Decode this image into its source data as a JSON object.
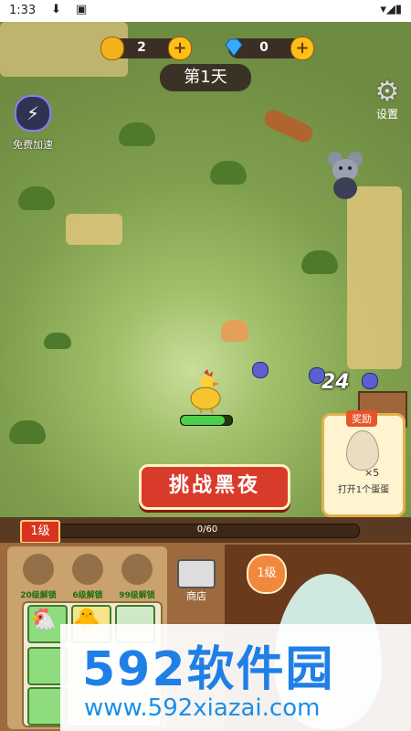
{
  "status_bar": {
    "time": "1:33",
    "left_icons": "⬇ ▣",
    "right_icons": "▾◢▮"
  },
  "currency": {
    "coins": {
      "value": "2",
      "icon": "coin-icon",
      "color": "#f3b21b"
    },
    "diamonds": {
      "value": "0",
      "icon": "diamond-icon",
      "color": "#3aa9ff"
    }
  },
  "hud": {
    "day": "第1天",
    "settings": "设置",
    "free_speed": "免费加速"
  },
  "battle": {
    "damage": "24",
    "player_hp": 0.85
  },
  "buttons": {
    "challenge_night": "挑战黑夜"
  },
  "egg_reward": {
    "label": "奖励",
    "count": "×5",
    "text": "打开1个蛋蛋"
  },
  "level_bar": {
    "level": "1级",
    "xp_text": "0/60",
    "xp_fraction": 0.0
  },
  "unlocks": [
    "20级解锁",
    "6级解锁",
    "99级解锁"
  ],
  "shop": {
    "label": "商店"
  },
  "right_panel": {
    "level": "1级"
  },
  "watermark": {
    "title": "592软件园",
    "url": "www.592xiazai.com"
  }
}
